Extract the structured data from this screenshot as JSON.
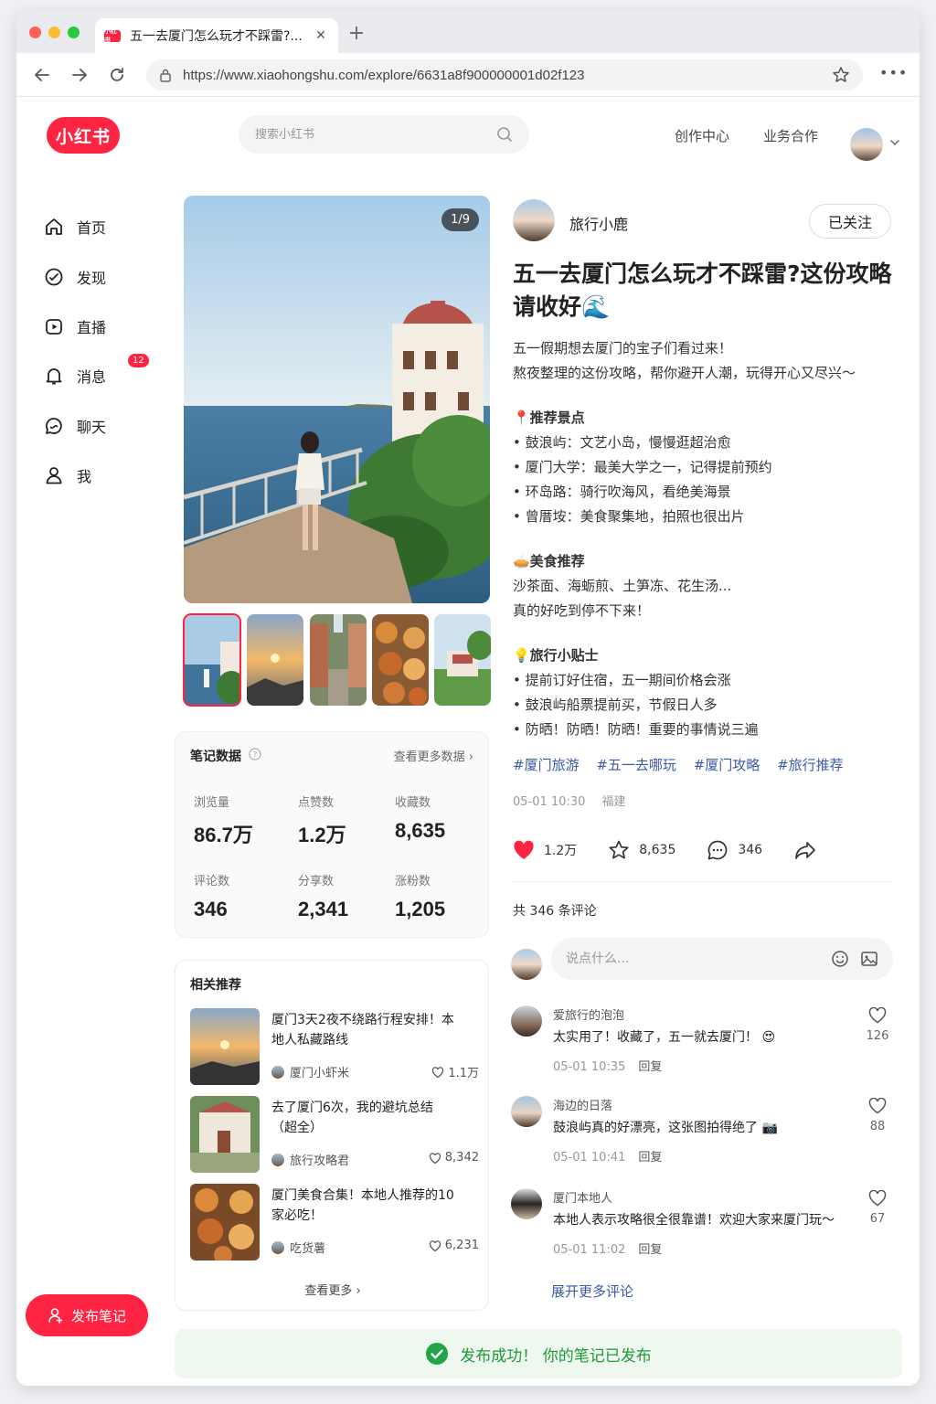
{
  "browser": {
    "tab_title": "五一去厦门怎么玩才不踩雷?...",
    "tab_favicon": "小红书",
    "url": "https://www.xiaohongshu.com/explore/6631a8f900000001d02f123"
  },
  "header": {
    "logo": "小红书",
    "search_placeholder": "搜索小红书",
    "links": [
      "创作中心",
      "业务合作"
    ]
  },
  "sidebar": {
    "items": [
      {
        "label": "首页",
        "icon": "home-icon"
      },
      {
        "label": "发现",
        "icon": "compass-icon"
      },
      {
        "label": "直播",
        "icon": "live-icon"
      },
      {
        "label": "消息",
        "icon": "bell-icon",
        "badge": "12"
      },
      {
        "label": "聊天",
        "icon": "chat-icon"
      },
      {
        "label": "我",
        "icon": "user-icon"
      }
    ],
    "publish_label": "发布笔记"
  },
  "gallery": {
    "counter": "1/9"
  },
  "stats": {
    "title": "笔记数据",
    "more": "查看更多数据 ›",
    "items": [
      {
        "label": "浏览量",
        "value": "86.7万"
      },
      {
        "label": "点赞数",
        "value": "1.2万"
      },
      {
        "label": "收藏数",
        "value": "8,635"
      },
      {
        "label": "评论数",
        "value": "346"
      },
      {
        "label": "分享数",
        "value": "2,341"
      },
      {
        "label": "涨粉数",
        "value": "1,205"
      }
    ]
  },
  "recommend": {
    "title": "相关推荐",
    "items": [
      {
        "title": "厦门3天2夜不绕路行程安排！本地人私藏路线",
        "author": "厦门小虾米",
        "likes": "1.1万"
      },
      {
        "title": "去了厦门6次，我的避坑总结（超全）",
        "author": "旅行攻略君",
        "likes": "8,342"
      },
      {
        "title": "厦门美食合集！本地人推荐的10家必吃！",
        "author": "吃货薯",
        "likes": "6,231"
      }
    ],
    "more": "查看更多 ›"
  },
  "note": {
    "author": "旅行小鹿",
    "follow_label": "已关注",
    "title": "五一去厦门怎么玩才不踩雷?这份攻略请收好🌊",
    "intro": [
      "五一假期想去厦门的宝子们看过来！",
      "熬夜整理的这份攻略，帮你避开人潮，玩得开心又尽兴～"
    ],
    "sections": [
      {
        "head": "📍推荐景点",
        "lines": [
          "• 鼓浪屿：文艺小岛，慢慢逛超治愈",
          "• 厦门大学：最美大学之一，记得提前预约",
          "• 环岛路：骑行吹海风，看绝美海景",
          "• 曾厝垵：美食聚集地，拍照也很出片"
        ]
      },
      {
        "head": "🥧美食推荐",
        "lines": [
          "沙茶面、海蛎煎、土笋冻、花生汤...",
          "真的好吃到停不下来！"
        ]
      },
      {
        "head": "💡旅行小贴士",
        "lines": [
          "• 提前订好住宿，五一期间价格会涨",
          "• 鼓浪屿船票提前买，节假日人多",
          "• 防晒！防晒！防晒！重要的事情说三遍"
        ]
      }
    ],
    "hashtags": [
      "#厦门旅游",
      "#五一去哪玩",
      "#厦门攻略",
      "#旅行推荐"
    ],
    "date": "05-01 10:30",
    "location": "福建",
    "likes": "1.2万",
    "collects": "8,635",
    "comments": "346"
  },
  "comments": {
    "count_label": "共 346 条评论",
    "input_placeholder": "说点什么...",
    "items": [
      {
        "user": "爱旅行的泡泡",
        "text": "太实用了！收藏了，五一就去厦门！ 😍",
        "time": "05-01 10:35",
        "reply": "回复",
        "likes": "126"
      },
      {
        "user": "海边的日落",
        "text": "鼓浪屿真的好漂亮，这张图拍得绝了 📷",
        "time": "05-01 10:41",
        "reply": "回复",
        "likes": "88"
      },
      {
        "user": "厦门本地人",
        "text": "本地人表示攻略很全很靠谱！欢迎大家来厦门玩～",
        "time": "05-01 11:02",
        "reply": "回复",
        "likes": "67"
      }
    ],
    "expand": "展开更多评论"
  },
  "toast": {
    "text": "发布成功！ 你的笔记已发布"
  }
}
